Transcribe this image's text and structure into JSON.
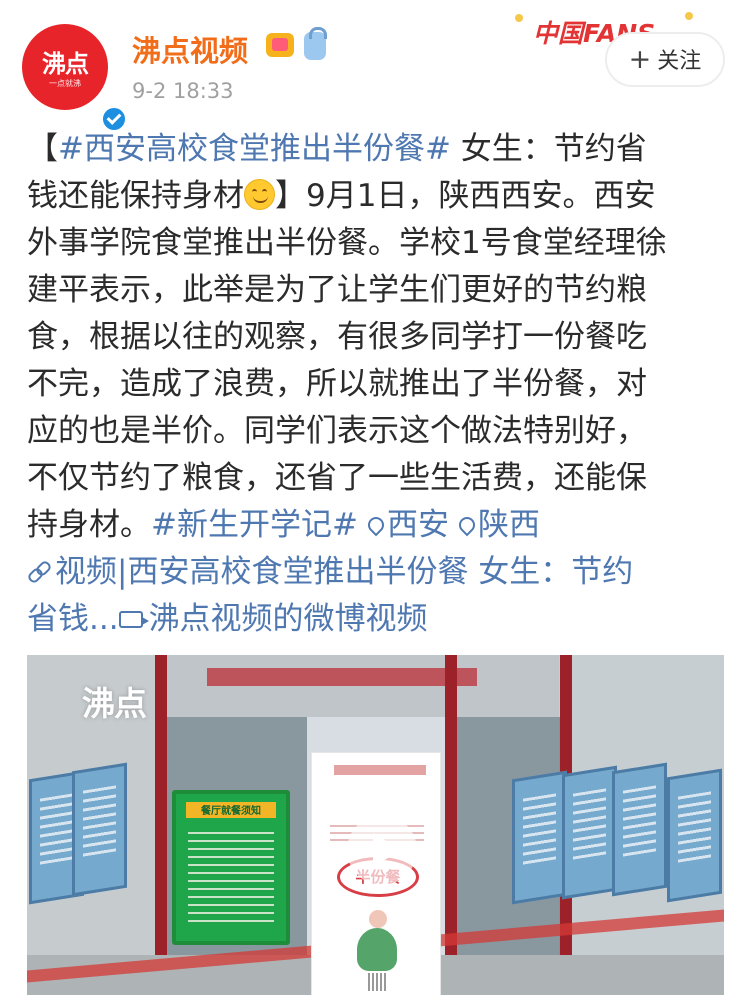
{
  "account": {
    "name": "沸点视频",
    "avatar_text": "沸点",
    "avatar_subtext": "一点就沸",
    "timestamp": "9-2 18:33",
    "fans_badge": "中国FANS",
    "follow_label": "关注",
    "follow_icon": "plus-icon"
  },
  "post": {
    "title_open": "【",
    "topic_1": "#西安高校食堂推出半份餐#",
    "title_rest": " 女生：节约省",
    "line_2a": "钱还能保持身材",
    "line_2b": "】9月1日，陕西西安。西安",
    "line_3": "外事学院食堂推出半份餐。学校1号食堂经理徐",
    "line_4": "建平表示，此举是为了让学生们更好的节约粮",
    "line_5": "食，根据以往的观察，有很多同学打一份餐吃",
    "line_6": "不完，造成了浪费，所以就推出了半份餐，对",
    "line_7": "应的也是半价。同学们表示这个做法特别好，",
    "line_8": "不仅节约了粮食，还省了一些生活费，还能保",
    "line_9": "持身材。",
    "topic_2": "#新生开学记#",
    "location_1": "西安",
    "location_2": "陕西",
    "link_1": "视频|西安高校食堂推出半份餐 女生：节约",
    "link_2": "省钱...",
    "video_link": "沸点视频的微博视频"
  },
  "media": {
    "watermark": "沸点",
    "poster_word": "半份餐",
    "green_board_title": "餐厅就餐须知"
  },
  "colors": {
    "brand_red": "#e8242b",
    "username_orange": "#f26d1a",
    "link_blue": "#4f78b1",
    "text": "#2b2b2b"
  }
}
